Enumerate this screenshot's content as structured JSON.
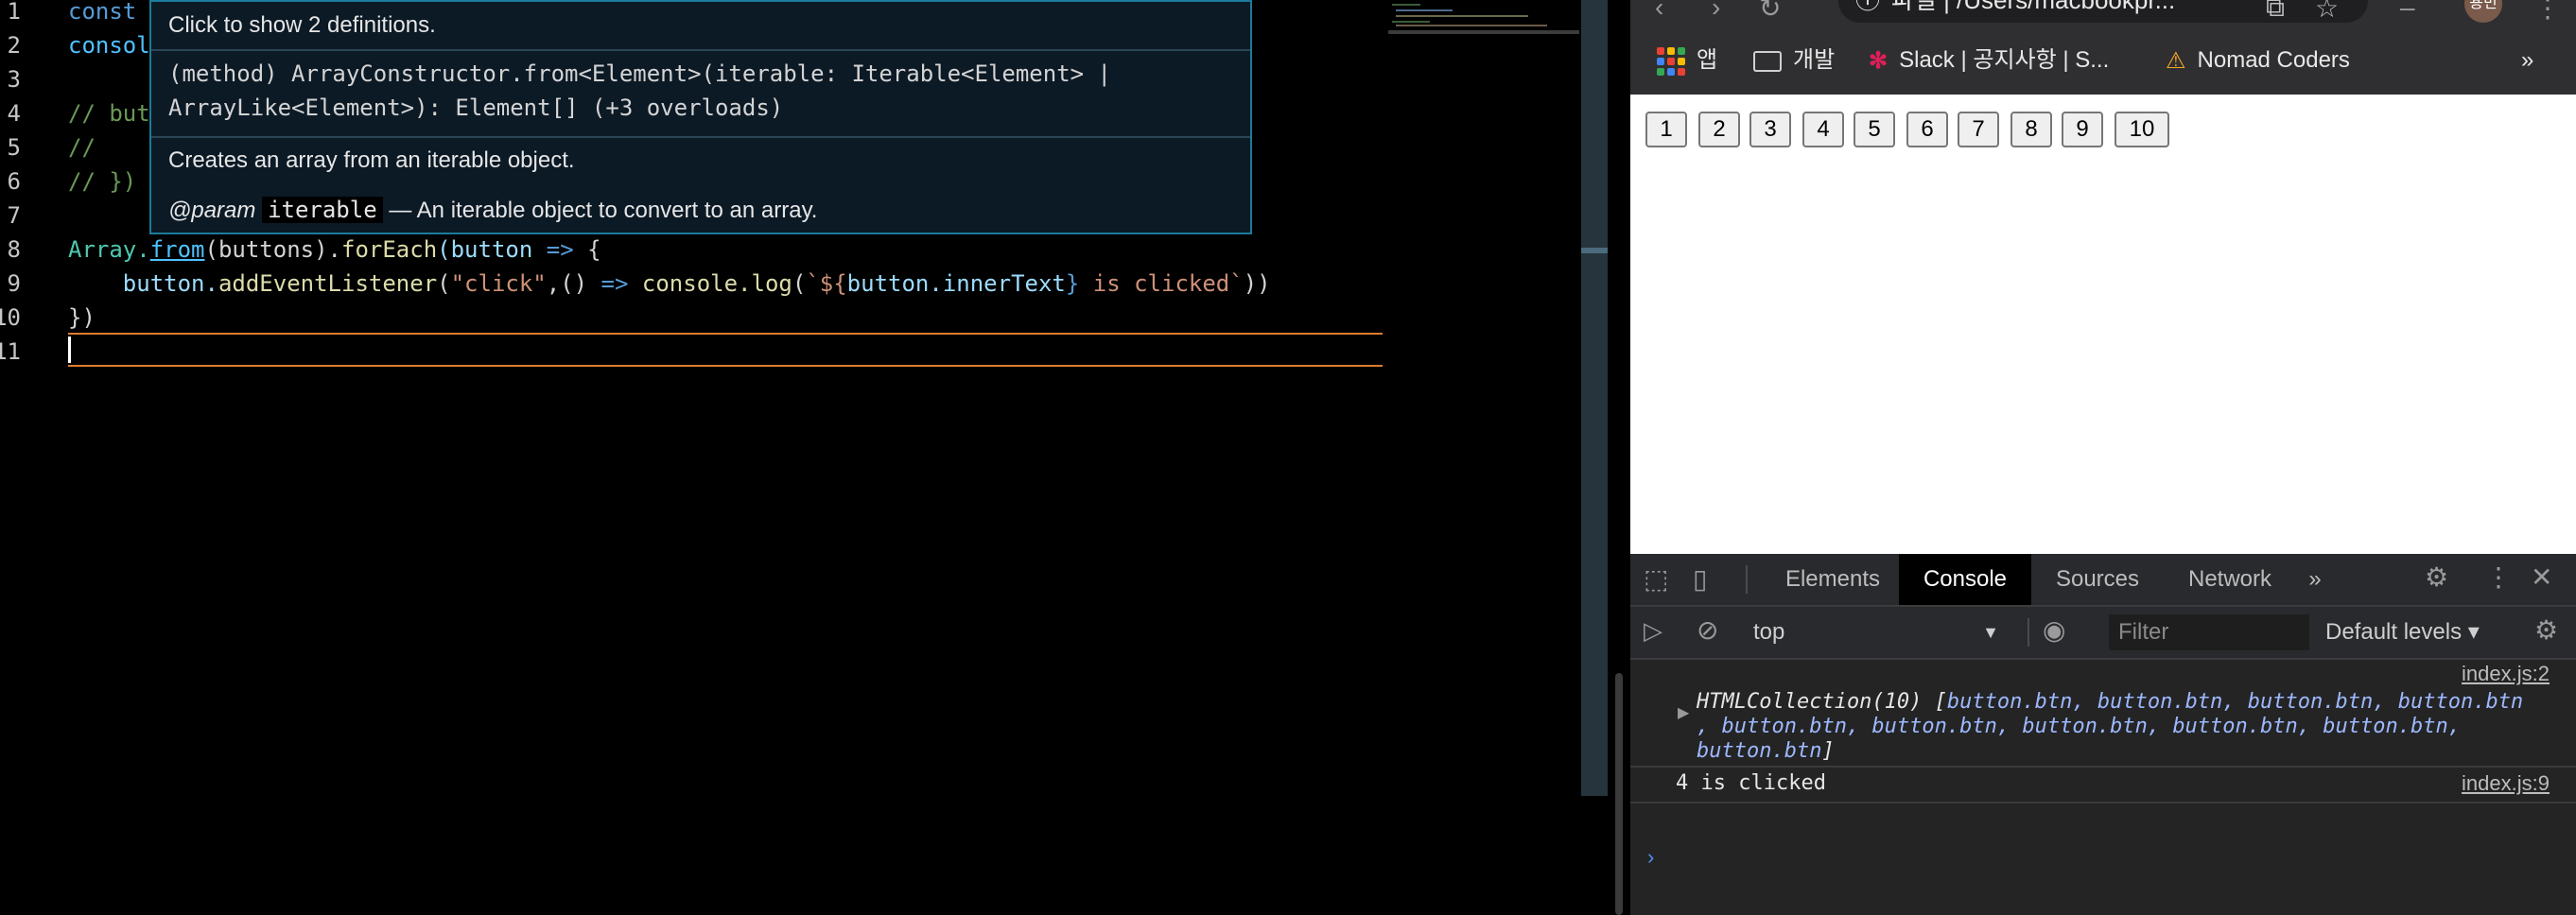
{
  "editor": {
    "line_numbers": [
      "1",
      "2",
      "3",
      "4",
      "5",
      "6",
      "7",
      "8",
      "9",
      "10",
      "11"
    ],
    "lines": {
      "l1": "const",
      "l2": "consol",
      "l4": "// but",
      "l5": "//",
      "l6": "// })",
      "l8_a": "Array.",
      "l8_b": "from",
      "l8_c": "(buttons).",
      "l8_d": "forEach",
      "l8_e": "(button ",
      "l8_f": "=>",
      "l8_g": " {",
      "l9_a": "    button.",
      "l9_b": "addEventListener",
      "l9_c": "(",
      "l9_d": "\"click\"",
      "l9_e": ",() ",
      "l9_f": "=>",
      "l9_g": " console.",
      "l9_h": "log",
      "l9_i": "(",
      "l9_j": "`${",
      "l9_k": "button.innerText",
      "l9_l": "}",
      "l9_m": " is clicked`",
      "l9_n": "))",
      "l10": "})"
    },
    "hover": {
      "header": "Click to show 2 definitions.",
      "signature": "(method) ArrayConstructor.from<Element>(iterable: Iterable<Element> | ArrayLike<Element>): Element[] (+3 overloads)",
      "description": "Creates an array from an iterable object.",
      "param_tag": "@param",
      "param_name": "iterable",
      "param_desc": "— An iterable object to convert to an array."
    }
  },
  "browser": {
    "url": "파일 | /Users/macbookpr...",
    "avatar": "용민",
    "bookmarks": {
      "apps": "앱",
      "dev": "개발",
      "slack": "Slack | 공지사항 | S...",
      "nomad": "Nomad Coders",
      "more": "»"
    },
    "page_buttons": [
      "1",
      "2",
      "3",
      "4",
      "5",
      "6",
      "7",
      "8",
      "9",
      "10"
    ],
    "devtools": {
      "tabs": {
        "elements": "Elements",
        "console": "Console",
        "sources": "Sources",
        "network": "Network",
        "more": "»"
      },
      "context": "top",
      "filter_placeholder": "Filter",
      "levels": "Default levels ▾",
      "messages": {
        "m1_source": "index.js:2",
        "m1_line1_a": "HTMLCollection(10) [",
        "m1_line1_b": "button.btn, button.btn, button.btn, button.btn",
        "m1_line2": ", button.btn, button.btn, button.btn, button.btn, button.btn,",
        "m1_line3_a": "button.btn",
        "m1_line3_b": "]",
        "m2_text": "4 is clicked",
        "m2_source": "index.js:9"
      }
    }
  }
}
